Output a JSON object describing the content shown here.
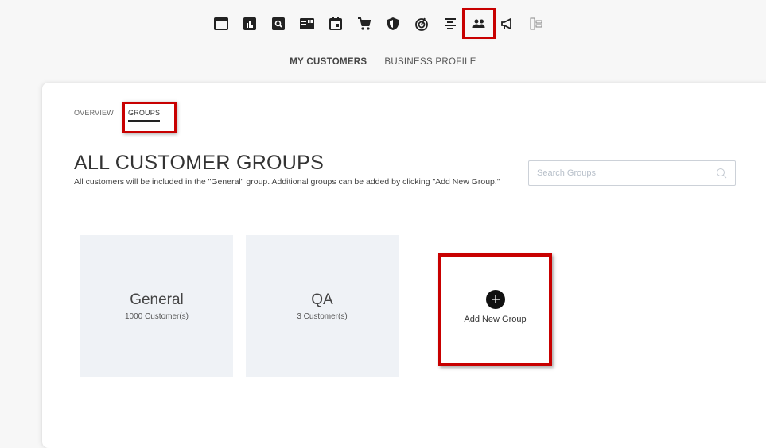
{
  "top_nav": {
    "icons": [
      {
        "name": "window-icon"
      },
      {
        "name": "bar-chart-icon"
      },
      {
        "name": "search-box-icon"
      },
      {
        "name": "quote-card-icon"
      },
      {
        "name": "calendar-icon"
      },
      {
        "name": "cart-icon"
      },
      {
        "name": "shield-icon"
      },
      {
        "name": "radar-icon"
      },
      {
        "name": "align-center-icon"
      },
      {
        "name": "people-icon",
        "active": true
      },
      {
        "name": "megaphone-icon"
      },
      {
        "name": "org-chart-icon"
      }
    ],
    "active_color": "#c80000"
  },
  "subnav": {
    "my_customers": "MY CUSTOMERS",
    "business_profile": "BUSINESS PROFILE"
  },
  "tabs": {
    "overview": "OVERVIEW",
    "groups": "GROUPS"
  },
  "page": {
    "title": "ALL CUSTOMER GROUPS",
    "description": "All customers will be included in the \"General\" group. Additional groups can be added by clicking \"Add New Group.\""
  },
  "search": {
    "placeholder": "Search Groups",
    "value": ""
  },
  "groups": [
    {
      "name": "General",
      "count": "1000 Customer(s)"
    },
    {
      "name": "QA",
      "count": "3 Customer(s)"
    }
  ],
  "add_group": {
    "label": "Add New Group"
  },
  "colors": {
    "highlight": "#c80000",
    "tile_bg": "#eff2f6"
  }
}
